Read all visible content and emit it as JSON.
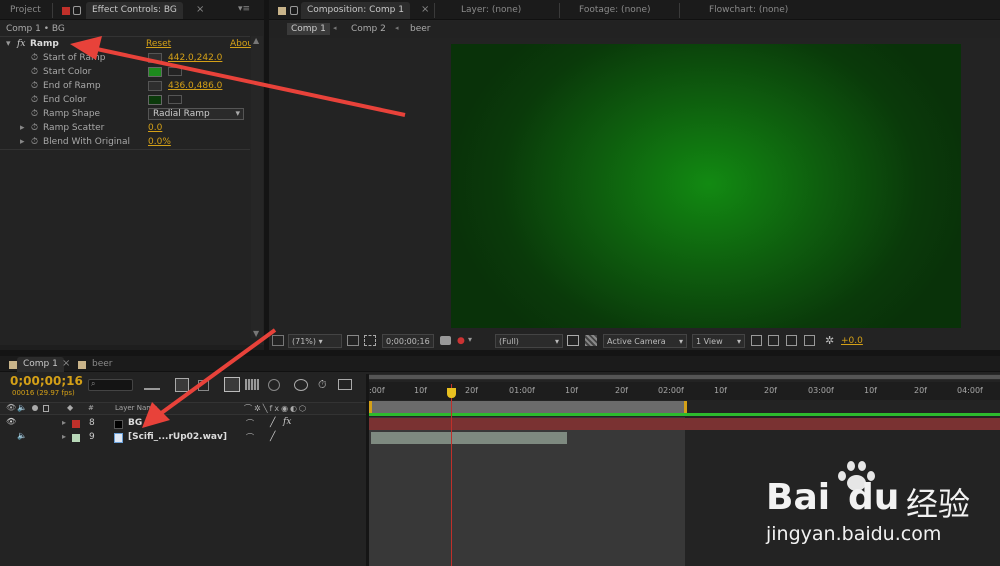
{
  "top_tabs_left": {
    "project": "Project",
    "effect_controls": "Effect Controls: BG"
  },
  "top_tabs_right": {
    "composition": "Composition: Comp 1",
    "layer": "Layer: (none)",
    "footage": "Footage: (none)",
    "flowchart": "Flowchart: (none)"
  },
  "effect_controls": {
    "breadcrumb": "Comp 1 • BG",
    "effect_name": "Ramp",
    "reset_label": "Reset",
    "about_label": "Abou",
    "props": [
      {
        "name": "Start of Ramp",
        "value": "442.0,242.0"
      },
      {
        "name": "Start Color",
        "value": ""
      },
      {
        "name": "End of Ramp",
        "value": "436.0,486.0"
      },
      {
        "name": "End Color",
        "value": ""
      },
      {
        "name": "Ramp Shape",
        "value": "Radial Ramp"
      },
      {
        "name": "Ramp Scatter",
        "value": "0.0"
      },
      {
        "name": "Blend With Original",
        "value": "0.0%"
      }
    ],
    "colors": {
      "start": "#1d8a1d",
      "end": "#0b3a0b"
    }
  },
  "comp_nav": {
    "comp1": "Comp 1",
    "comp2": "Comp 2",
    "beer": "beer"
  },
  "viewer_toolbar": {
    "zoom": "(71%)",
    "timecode": "0;00;00;16",
    "resolution": "(Full)",
    "camera": "Active Camera",
    "view": "1 View",
    "exposure": "+0.0"
  },
  "timeline": {
    "tabs": {
      "comp1": "Comp 1",
      "beer": "beer"
    },
    "timecode": "0;00;00;16",
    "fps": "00016 (29.97 fps)",
    "col_layer_name": "Layer Name",
    "col_num": "#",
    "layers": [
      {
        "num": "8",
        "name": "BG",
        "color": "#c0302a"
      },
      {
        "num": "9",
        "name": "[Scifi_...rUp02.wav]",
        "color": "#b8d8b8"
      }
    ],
    "ruler": [
      ":00f",
      "10f",
      "20f",
      "01:00f",
      "10f",
      "20f",
      "02:00f",
      "10f",
      "20f",
      "03:00f",
      "10f",
      "20f",
      "04:00f"
    ]
  },
  "watermark": {
    "brand": "Bai",
    "brand2": "du",
    "cn": "经验",
    "url": "jingyan.baidu.com"
  }
}
